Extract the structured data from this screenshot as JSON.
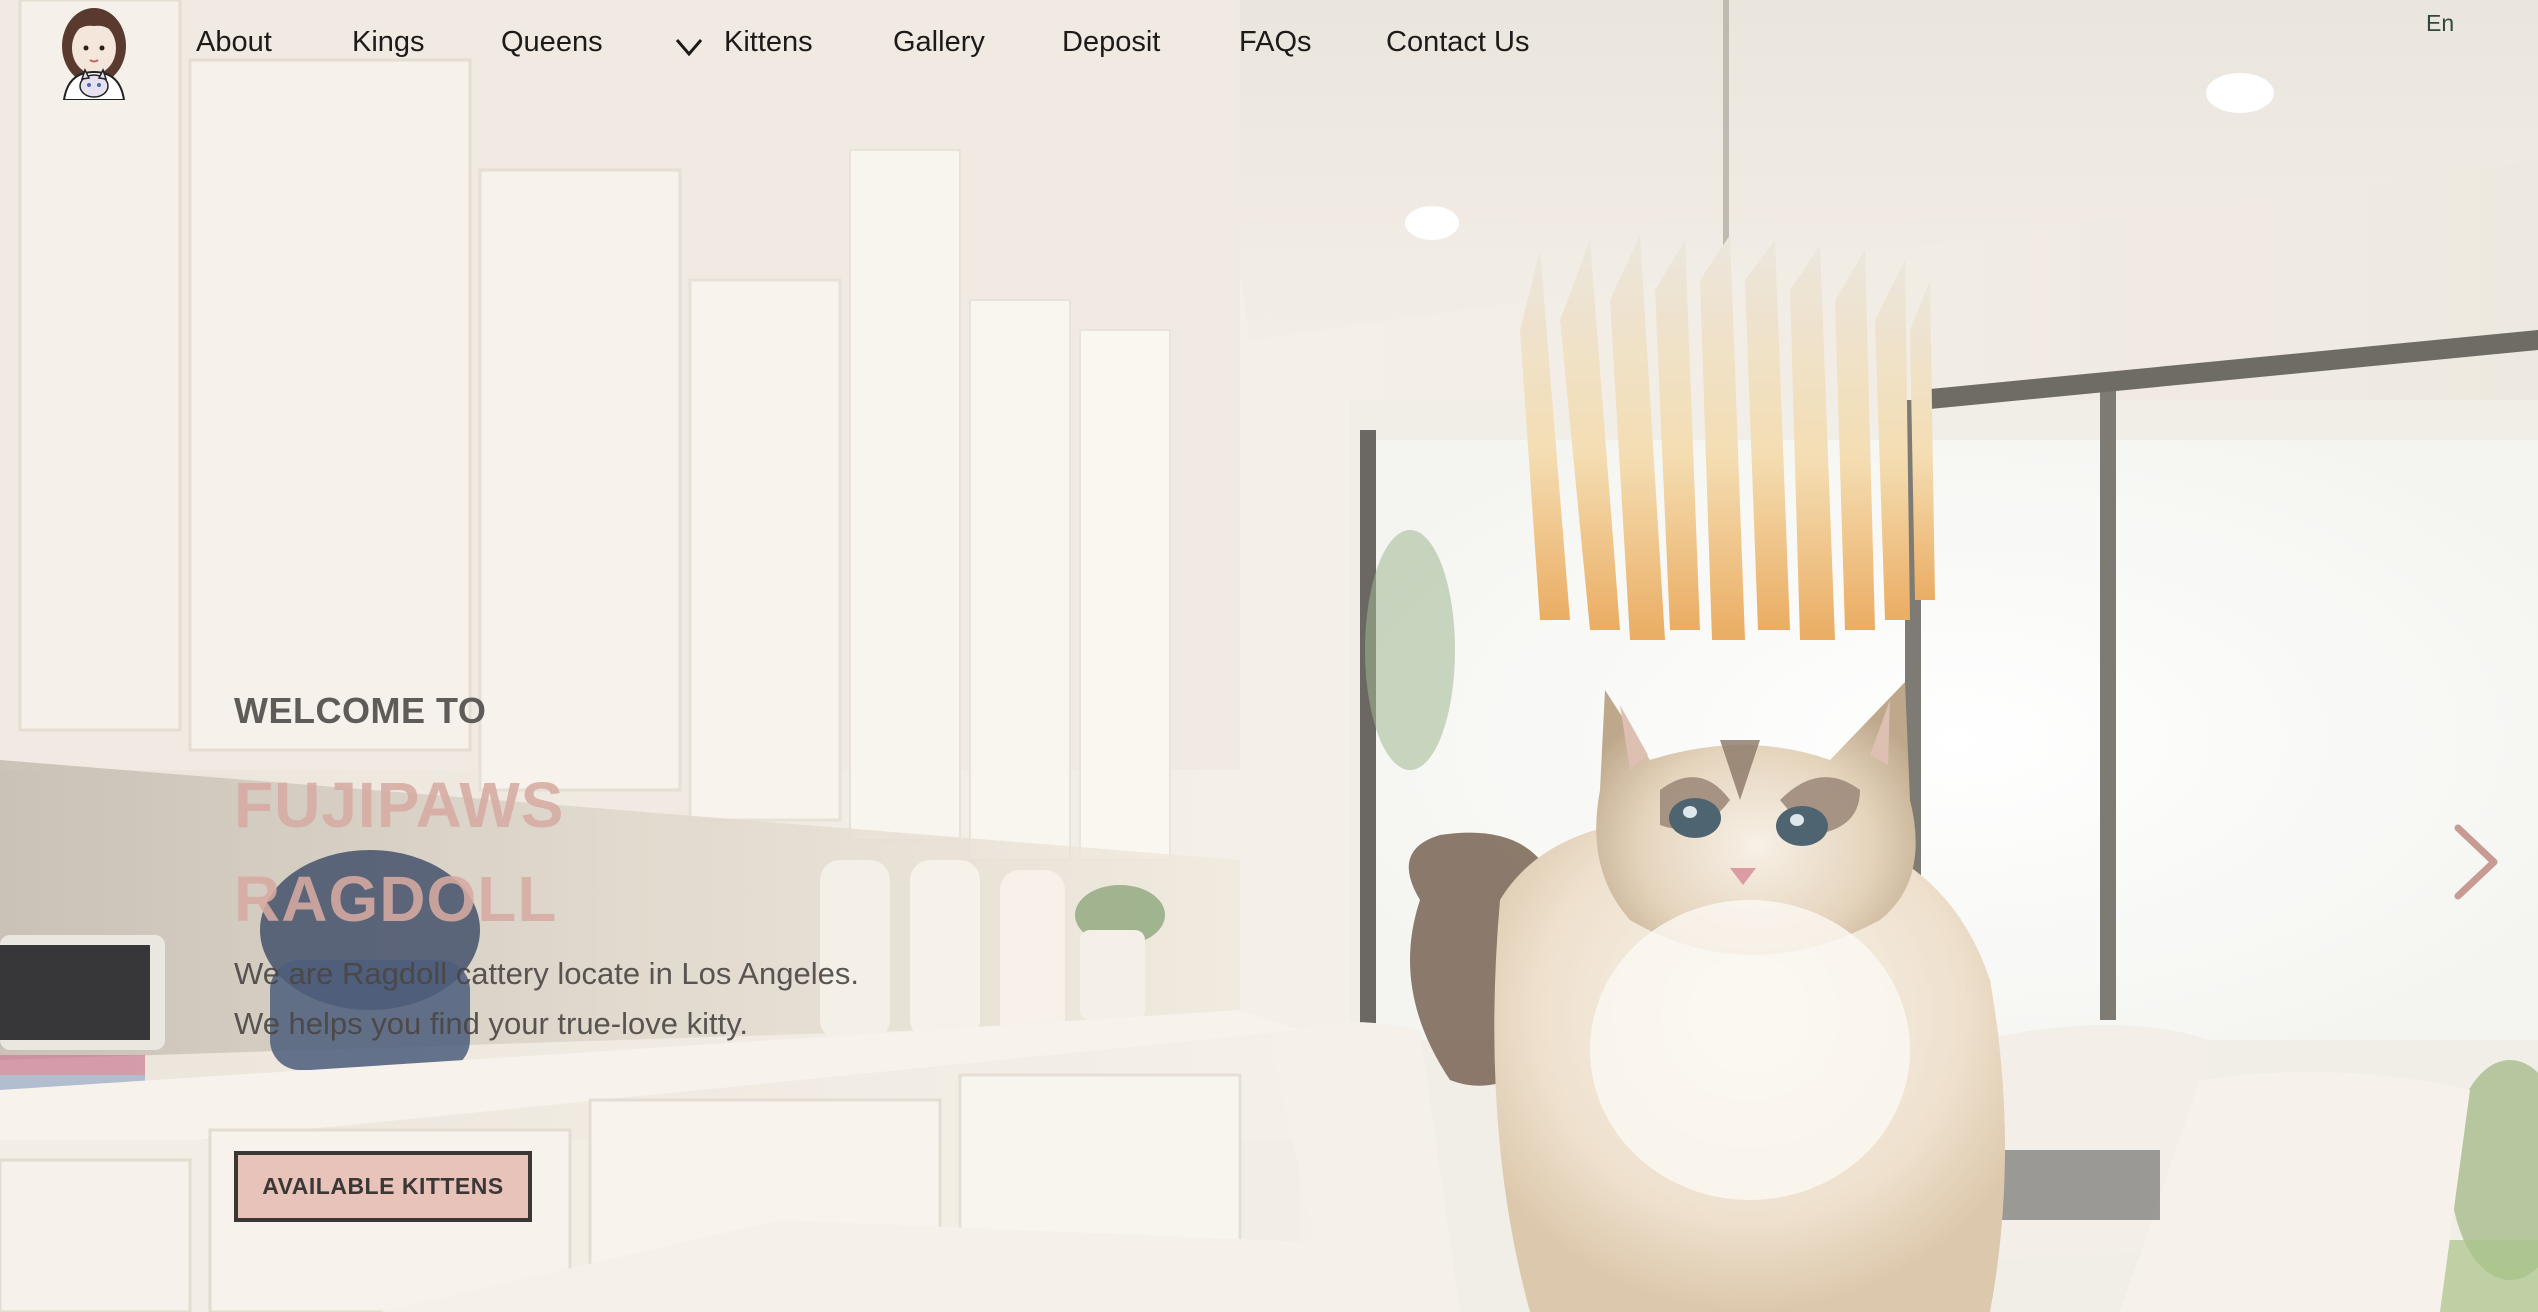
{
  "nav": {
    "items": [
      {
        "label": "About"
      },
      {
        "label": "Kings"
      },
      {
        "label": "Queens"
      },
      {
        "label": "Kittens"
      },
      {
        "label": "Gallery"
      },
      {
        "label": "Deposit"
      },
      {
        "label": "FAQs"
      },
      {
        "label": "Contact Us"
      }
    ],
    "language": "En"
  },
  "hero": {
    "welcome": "WELCOME TO",
    "brand_line1": "FUJIPAWS",
    "brand_line2": "RAGDOLL",
    "description_line1": "We are Ragdoll cattery locate in Los Angeles.",
    "description_line2": "We helps you find your true-love kitty.",
    "cta_label": "AVAILABLE KITTENS"
  },
  "colors": {
    "brand_pink": "#d7aba3",
    "button_fill": "#e8c3ba",
    "button_border": "#3b3735",
    "nav_text": "#1d1b19",
    "lang_text": "#2f4a3c"
  },
  "icons": {
    "logo": "girl-with-cat-avatar",
    "dropdown": "chevron-down-icon",
    "carousel_next": "chevron-right-icon"
  }
}
